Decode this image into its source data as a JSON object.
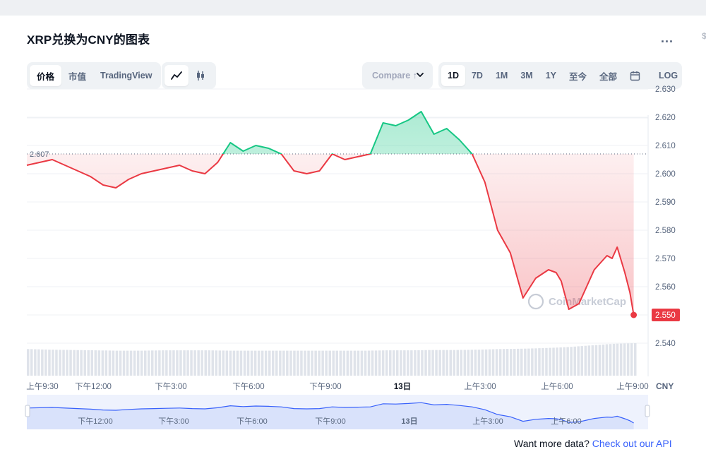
{
  "title": "XRP兑换为CNY的图表",
  "more_label": "...",
  "edge_mark": "$",
  "type_tabs": [
    "价格",
    "市值",
    "TradingView"
  ],
  "type_tabs_active": 0,
  "mode_icons": [
    "line-chart-icon",
    "candlestick-icon"
  ],
  "compare": {
    "label": "Compare ↑",
    "icon": "chevron-down-icon"
  },
  "range_tabs": [
    "1D",
    "7D",
    "1M",
    "3M",
    "1Y",
    "至今",
    "全部"
  ],
  "range_tabs_active": 0,
  "calendar_icon": "calendar-icon",
  "log_label": "LOG",
  "watermark": "CoinMarketCap",
  "footer": {
    "text": "Want more data?",
    "link": "Check out our API"
  },
  "colors": {
    "up": "#16c784",
    "down": "#ea3943",
    "nav_fill": "#d9e2fb",
    "nav_line": "#3861fb"
  },
  "chart_data": {
    "type": "line",
    "currency": "CNY",
    "reference_price": 2.607,
    "reference_label": "2.607",
    "last_price": 2.55,
    "last_label": "2.550",
    "ylim": [
      2.532,
      2.632
    ],
    "y_ticks": [
      "2.630",
      "2.620",
      "2.610",
      "2.600",
      "2.590",
      "2.580",
      "2.570",
      "2.560",
      "2.550",
      "2.540"
    ],
    "x_ticks": [
      "上午9:30",
      "下午12:00",
      "下午3:00",
      "下午6:00",
      "下午9:00",
      "13日",
      "上午3:00",
      "上午6:00",
      "上午9:00"
    ],
    "x_ticks_bold": [
      "13日"
    ],
    "navigator_ticks": [
      "下午12:00",
      "下午3:00",
      "下午6:00",
      "下午9:00",
      "13日",
      "上午3:00",
      "上午6:00"
    ],
    "x_hours": [
      0,
      1,
      2,
      2.5,
      3,
      3.5,
      4,
      4.5,
      5,
      5.5,
      6,
      6.5,
      7,
      7.5,
      8,
      8.5,
      9,
      9.5,
      10,
      10.5,
      11,
      11.5,
      12,
      12.5,
      13,
      13.5,
      14,
      14.5,
      15,
      15.5,
      16,
      16.5,
      17,
      17.5,
      18,
      18.5,
      19,
      19.5,
      20,
      20.5,
      20.8,
      21,
      21.3,
      21.7,
      22,
      22.3,
      22.5,
      22.8,
      23,
      23.2,
      23.5,
      23.7,
      23.85
    ],
    "values": [
      2.603,
      2.605,
      2.601,
      2.599,
      2.596,
      2.595,
      2.598,
      2.6,
      2.601,
      2.602,
      2.603,
      2.601,
      2.6,
      2.604,
      2.611,
      2.608,
      2.61,
      2.609,
      2.607,
      2.601,
      2.6,
      2.601,
      2.607,
      2.605,
      2.606,
      2.607,
      2.618,
      2.617,
      2.619,
      2.622,
      2.614,
      2.616,
      2.612,
      2.607,
      2.597,
      2.58,
      2.572,
      2.556,
      2.563,
      2.566,
      2.565,
      2.562,
      2.552,
      2.554,
      2.56,
      2.566,
      2.568,
      2.571,
      2.57,
      2.574,
      2.565,
      2.558,
      2.55
    ],
    "volume": [
      0.82,
      0.8,
      0.79,
      0.78,
      0.77,
      0.77,
      0.78,
      0.78,
      0.78,
      0.77,
      0.77,
      0.77,
      0.77,
      0.77,
      0.77,
      0.77,
      0.78,
      0.78,
      0.79,
      0.79,
      0.8,
      0.82,
      0.83,
      0.85,
      0.88,
      0.93,
      0.98,
      1.0
    ],
    "grid": true,
    "legend": "none"
  }
}
